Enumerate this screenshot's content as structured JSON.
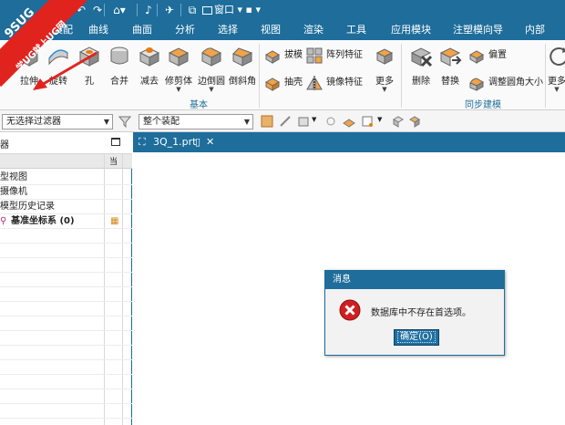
{
  "watermark": {
    "line1": "9SUG",
    "line2": "学UG就上UG网"
  },
  "quick_access": {
    "window_label": "窗口",
    "icons": [
      "part-icon",
      "undo-icon",
      "redo-icon",
      "view-icon",
      "voice-icon",
      "snap-icon",
      "copy-icon"
    ]
  },
  "menu": {
    "items": [
      "装配",
      "曲线",
      "曲面",
      "分析",
      "选择",
      "视图",
      "渲染",
      "工具",
      "应用模块",
      "注塑模向导",
      "内部"
    ]
  },
  "ribbon": {
    "main_buttons": [
      "拉伸",
      "旋转",
      "孔",
      "合并",
      "减去",
      "修剪体",
      "边倒圆",
      "倒斜角"
    ],
    "feature_small": [
      "拔模",
      "阵列特征",
      "抽壳",
      "镜像特征"
    ],
    "more_label": "更多",
    "group_basic": "基本",
    "sync_buttons": [
      "删除",
      "替换"
    ],
    "sync_small": [
      "偏置",
      "调整圆角大小"
    ],
    "group_sync": "同步建模",
    "overflow_label": "更多"
  },
  "filterbar": {
    "filter_value": "无选择过滤器",
    "scope_value": "整个装配"
  },
  "navigator": {
    "title": "器",
    "col_marker": "当",
    "rows": [
      "型视图",
      "摄像机",
      "模型历史记录",
      "基准坐标系 (0)"
    ]
  },
  "doc_tab": {
    "title": "3Q_1.prt"
  },
  "dialog": {
    "title": "消息",
    "message": "数据库中不存在首选项。",
    "ok_label": "确定(O)"
  },
  "colors": {
    "accent": "#1e6d9b",
    "watermark_red": "#e1231e",
    "error_red": "#cf1f22"
  }
}
